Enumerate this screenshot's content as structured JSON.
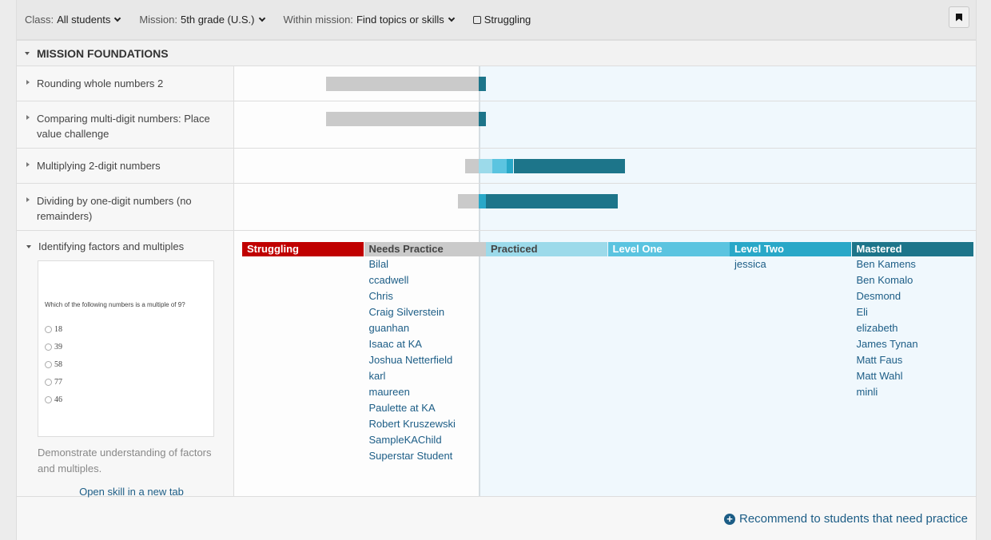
{
  "toolbar": {
    "filters": [
      {
        "label": "Class:",
        "value": "All students"
      },
      {
        "label": "Mission:",
        "value": "5th grade (U.S.)"
      },
      {
        "label": "Within mission:",
        "value": "Find topics or skills"
      }
    ],
    "checkbox_label": "Struggling",
    "checkbox_checked": false,
    "bookmark_icon": "bookmark-icon"
  },
  "section": {
    "title": "MISSION FOUNDATIONS"
  },
  "colors": {
    "struggling": "#c00000",
    "needs_practice": "#cacaca",
    "practiced": "#9cdaea",
    "level_one": "#5bc4e0",
    "level_two": "#29a8c8",
    "mastered": "#1d758a"
  },
  "skills": [
    {
      "title": "Rounding whole numbers 2",
      "counts": {
        "needs_practice": 22,
        "mastered": 1
      }
    },
    {
      "title": "Comparing multi-digit numbers: Place value challenge",
      "counts": {
        "needs_practice": 22,
        "mastered": 1
      }
    },
    {
      "title": "Multiplying 2-digit numbers",
      "counts": {
        "needs_practice": 2,
        "practiced": 2,
        "level_one": 2,
        "level_two": 1,
        "mastered": 16
      }
    },
    {
      "title": "Dividing by one-digit numbers (no remainders)",
      "counts": {
        "needs_practice": 3,
        "level_two": 1,
        "mastered": 19
      }
    }
  ],
  "expanded": {
    "title": "Identifying factors and multiples",
    "preview": {
      "question": "Which of the following numbers is a multiple of 9?",
      "options": [
        "18",
        "39",
        "58",
        "77",
        "46"
      ]
    },
    "description": "Demonstrate understanding of factors and multiples.",
    "open_link": "Open skill in a new tab",
    "legend": [
      {
        "key": "struggling",
        "label": "Struggling",
        "students": []
      },
      {
        "key": "needs_practice",
        "label": "Needs Practice",
        "students": [
          "Bilal",
          "ccadwell",
          "Chris",
          "Craig Silverstein",
          "guanhan",
          "Isaac at KA",
          "Joshua Netterfield",
          "karl",
          "maureen",
          "Paulette at KA",
          "Robert Kruszewski",
          "SampleKAChild",
          "Superstar Student"
        ]
      },
      {
        "key": "practiced",
        "label": "Practiced",
        "students": []
      },
      {
        "key": "level_one",
        "label": "Level One",
        "students": []
      },
      {
        "key": "level_two",
        "label": "Level Two",
        "students": [
          "jessica"
        ]
      },
      {
        "key": "mastered",
        "label": "Mastered",
        "students": [
          "Ben Kamens",
          "Ben Komalo",
          "Desmond",
          "Eli",
          "elizabeth",
          "James Tynan",
          "Matt Faus",
          "Matt Wahl",
          "minli"
        ]
      }
    ]
  },
  "recommend": {
    "label": "Recommend to students that need practice",
    "icon": "plus-circle-icon"
  }
}
